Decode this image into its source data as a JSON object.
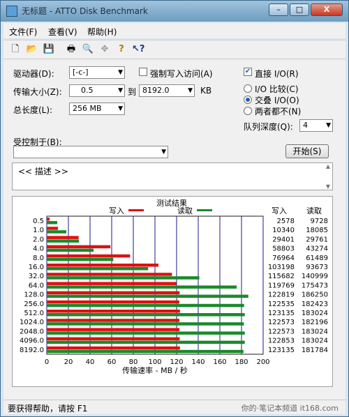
{
  "title": "无标题 - ATTO Disk Benchmark",
  "window_controls": {
    "minimize": "–",
    "maximize": "□",
    "close": "X"
  },
  "menu": [
    "文件(F)",
    "查看(V)",
    "帮助(H)"
  ],
  "toolbar_icons": [
    "new-icon",
    "open-icon",
    "save-icon",
    "print-icon",
    "print-preview-icon",
    "move-icon",
    "help-icon",
    "context-help-icon"
  ],
  "settings": {
    "drive_label": "驱动器(D):",
    "drive_value": "[-c-]",
    "transfer_label": "传输大小(Z):",
    "transfer_from": "0.5",
    "to_label": "到",
    "transfer_to": "8192.0",
    "unit": "KB",
    "length_label": "总长度(L):",
    "length_value": "256 MB",
    "force_write_label": "强制写入访问(A)",
    "direct_io_label": "直接 I/O(R)",
    "io_compare_label": "I/O 比较(C)",
    "overlap_io_label": "交叠 I/O(O)",
    "neither_label": "两者都不(N)",
    "queue_label": "队列深度(Q):",
    "queue_value": "4",
    "controlled_label": "受控制于(B):",
    "controlled_value": "",
    "start_label": "开始(S)",
    "description": "<< 描述 >>"
  },
  "chart_data": {
    "type": "bar",
    "title": "测试结果",
    "legend": [
      "写入",
      "读取"
    ],
    "xlabel": "传输速率 - MB / 秒",
    "xlim": [
      0,
      200
    ],
    "xticks": [
      "0",
      "20",
      "40",
      "60",
      "80",
      "100",
      "120",
      "140",
      "160",
      "180",
      "200"
    ],
    "col_headers": [
      "写入",
      "读取"
    ],
    "categories": [
      "0.5",
      "1.0",
      "2.0",
      "4.0",
      "8.0",
      "16.0",
      "32.0",
      "64.0",
      "128.0",
      "256.0",
      "512.0",
      "1024.0",
      "2048.0",
      "4096.0",
      "8192.0"
    ],
    "series": [
      {
        "name": "写入",
        "color": "#e01010",
        "values": [
          2.6,
          10.3,
          29.4,
          58.8,
          77.0,
          103.2,
          115.7,
          119.8,
          122.8,
          122.5,
          123.1,
          122.6,
          122.6,
          122.9,
          123.1
        ],
        "labels": [
          "2578",
          "10340",
          "29401",
          "58803",
          "76964",
          "103198",
          "115682",
          "119769",
          "122819",
          "122535",
          "123135",
          "122573",
          "122573",
          "122853",
          "123135"
        ]
      },
      {
        "name": "读取",
        "color": "#1a8a2a",
        "values": [
          9.7,
          18.1,
          29.8,
          43.3,
          61.5,
          93.7,
          141.0,
          175.5,
          186.3,
          182.4,
          183.0,
          182.2,
          183.0,
          183.0,
          181.8
        ],
        "labels": [
          "9728",
          "18085",
          "29761",
          "43274",
          "61489",
          "93673",
          "140999",
          "175473",
          "186250",
          "182423",
          "183024",
          "182196",
          "183024",
          "183024",
          "181784"
        ]
      }
    ]
  },
  "status": "要获得帮助，请按 F1",
  "watermark": "你的·笔记本频道 it168.com",
  "colors": {
    "grid": "#1a1a8a",
    "write": "#e01010",
    "read": "#1a8a2a"
  }
}
